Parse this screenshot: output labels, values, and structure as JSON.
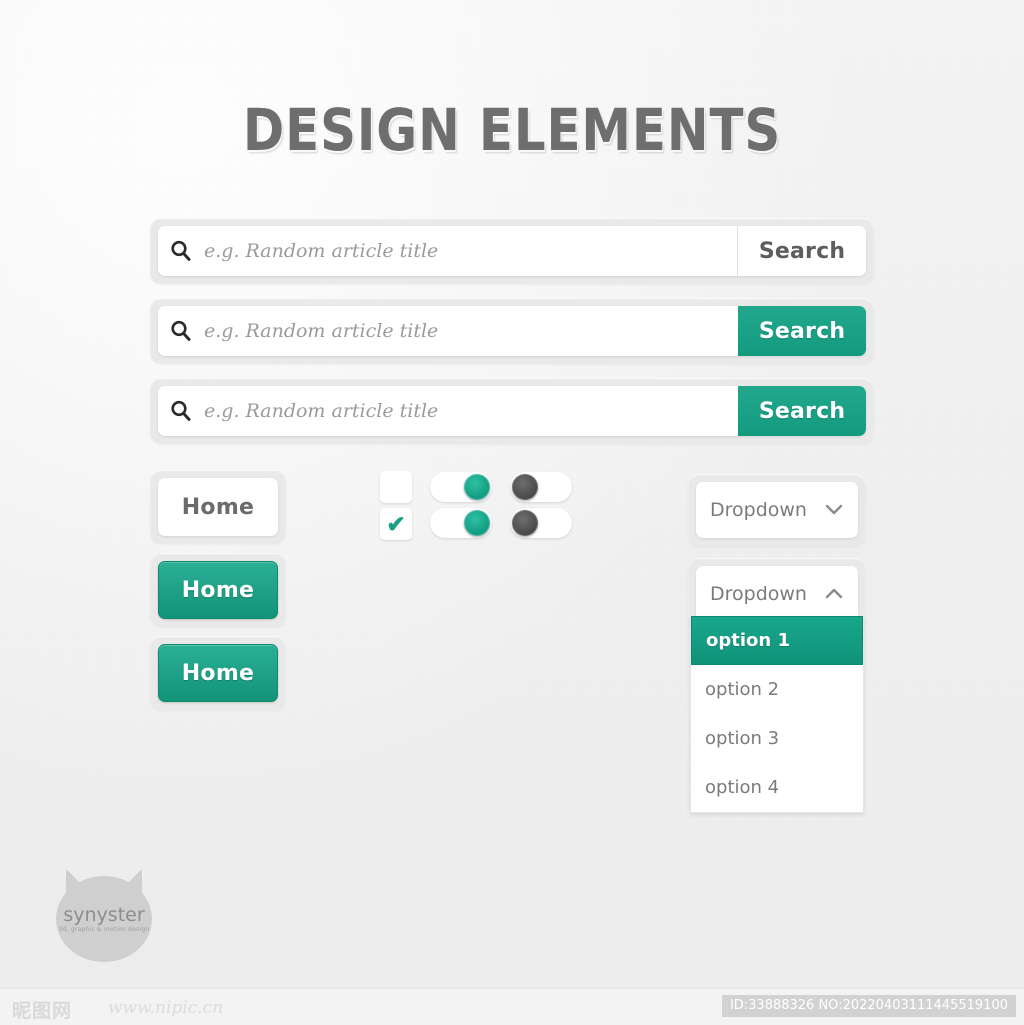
{
  "page": {
    "title": "DESIGN ELEMENTS",
    "accent_color": "#16a085",
    "background_color": "#f1f1f1",
    "text_gray": "#6e6e6e"
  },
  "search_bars": [
    {
      "icon": "search-icon",
      "placeholder": "e.g. Random article title",
      "value": "",
      "button_label": "Search",
      "style": "plain"
    },
    {
      "icon": "search-icon",
      "placeholder": "e.g. Random article title",
      "value": "",
      "button_label": "Search",
      "style": "teal-square"
    },
    {
      "icon": "search-icon",
      "placeholder": "e.g. Random article title",
      "value": "",
      "button_label": "Search",
      "style": "teal-rounded"
    }
  ],
  "home_buttons": [
    {
      "label": "Home",
      "style": "light"
    },
    {
      "label": "Home",
      "style": "teal"
    },
    {
      "label": "Home",
      "style": "teal"
    }
  ],
  "checkboxes": [
    {
      "checked": false,
      "mark": ""
    },
    {
      "checked": true,
      "mark": "✔"
    }
  ],
  "toggles": [
    {
      "state": "on",
      "knob_color": "#16a085"
    },
    {
      "state": "off",
      "knob_color": "#4d4d4d"
    },
    {
      "state": "on",
      "knob_color": "#16a085"
    },
    {
      "state": "off",
      "knob_color": "#4d4d4d"
    }
  ],
  "dropdown_closed": {
    "label": "Dropdown",
    "chevron": "chevron-down-icon"
  },
  "dropdown_open": {
    "label": "Dropdown",
    "chevron": "chevron-up-icon",
    "options": [
      {
        "label": "option 1",
        "selected": true
      },
      {
        "label": "option 2",
        "selected": false
      },
      {
        "label": "option 3",
        "selected": false
      },
      {
        "label": "option 4",
        "selected": false
      }
    ]
  },
  "logo": {
    "brand": "synyster",
    "tagline": "3d, graphic & motion design"
  },
  "watermark": {
    "site_cn": "昵图网",
    "url": "www.nipic.cn",
    "id_text": "ID:33888326 NO:20220403111445519100"
  }
}
